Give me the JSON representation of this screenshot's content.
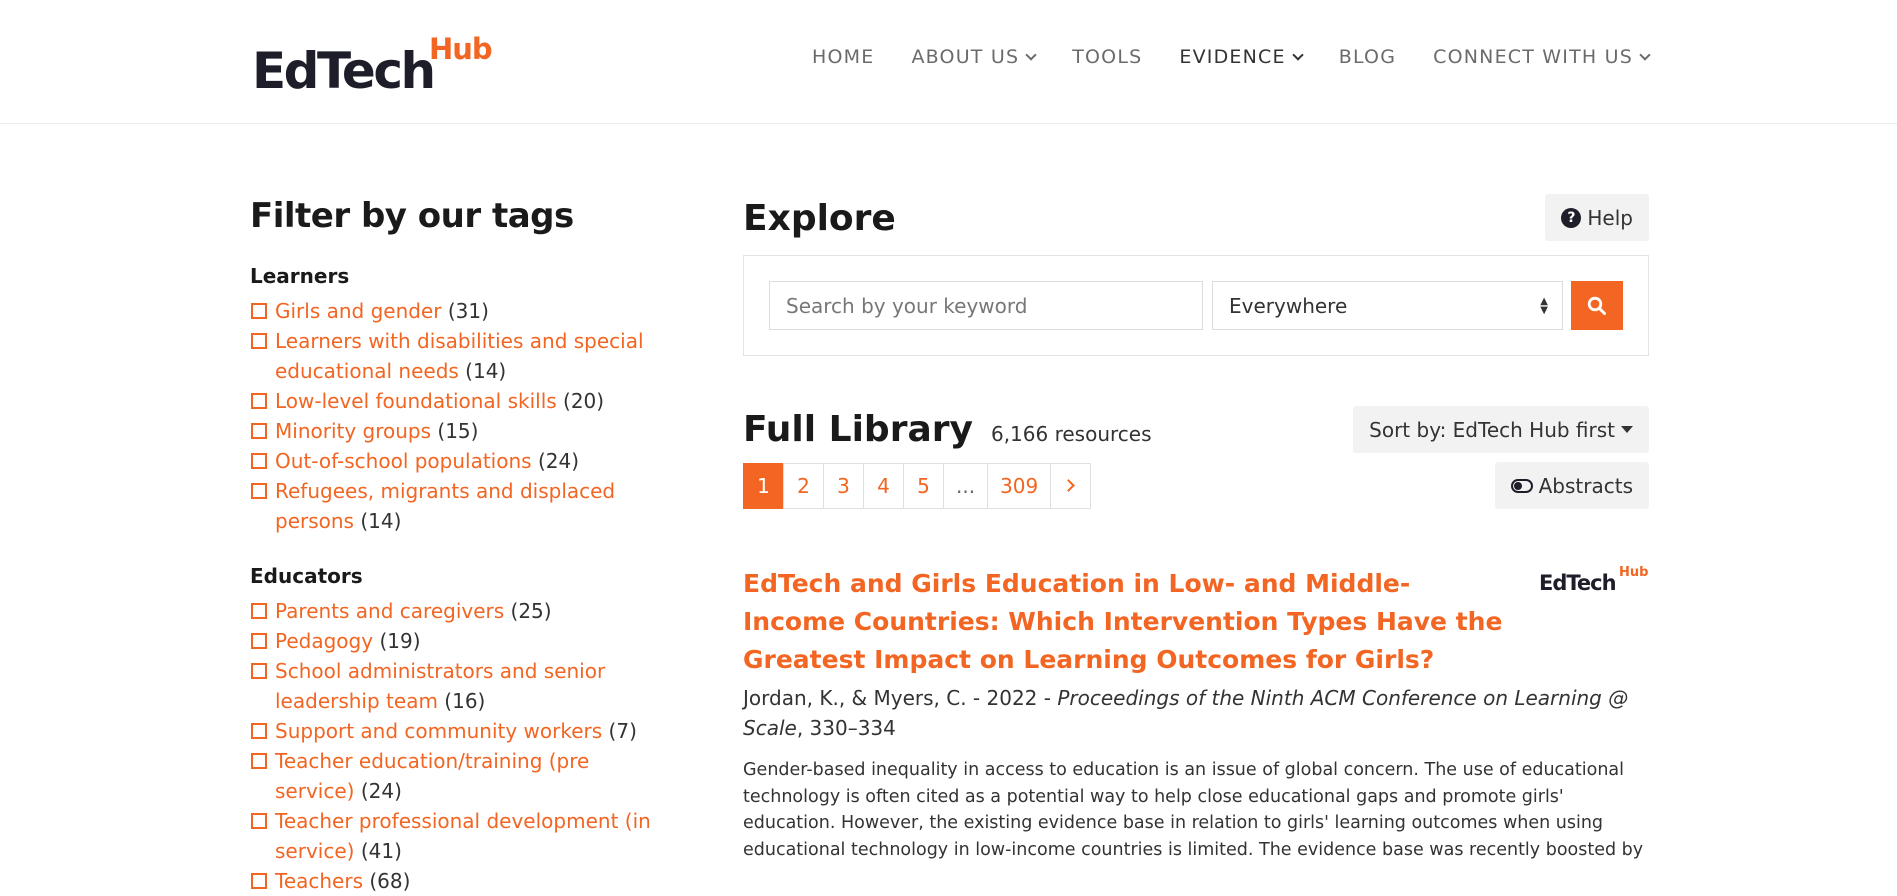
{
  "brand": {
    "main": "EdTech",
    "sup": "Hub"
  },
  "nav": [
    {
      "label": "HOME",
      "dropdown": false,
      "active": false
    },
    {
      "label": "ABOUT US",
      "dropdown": true,
      "active": false
    },
    {
      "label": "TOOLS",
      "dropdown": false,
      "active": false
    },
    {
      "label": "EVIDENCE",
      "dropdown": true,
      "active": true
    },
    {
      "label": "BLOG",
      "dropdown": false,
      "active": false
    },
    {
      "label": "CONNECT WITH US",
      "dropdown": true,
      "active": false
    }
  ],
  "sidebar": {
    "title": "Filter by our tags",
    "groups": [
      {
        "title": "Learners",
        "tags": [
          {
            "label": "Girls and gender",
            "count": "(31)"
          },
          {
            "label": "Learners with disabilities and special educational needs",
            "count": "(14)"
          },
          {
            "label": "Low-level foundational skills",
            "count": "(20)"
          },
          {
            "label": "Minority groups",
            "count": "(15)"
          },
          {
            "label": "Out-of-school populations",
            "count": "(24)"
          },
          {
            "label": "Refugees, migrants and displaced persons",
            "count": "(14)"
          }
        ]
      },
      {
        "title": "Educators",
        "tags": [
          {
            "label": "Parents and caregivers",
            "count": "(25)"
          },
          {
            "label": "Pedagogy",
            "count": "(19)"
          },
          {
            "label": "School administrators and senior leadership team",
            "count": "(16)"
          },
          {
            "label": "Support and community workers",
            "count": "(7)"
          },
          {
            "label": "Teacher education/training (pre service)",
            "count": "(24)"
          },
          {
            "label": "Teacher professional development (in service)",
            "count": "(41)"
          },
          {
            "label": "Teachers",
            "count": "(68)"
          }
        ]
      }
    ]
  },
  "explore": {
    "title": "Explore",
    "help_label": "Help",
    "search_placeholder": "Search by your keyword",
    "scope_value": "Everywhere"
  },
  "library": {
    "title": "Full Library",
    "count": "6,166 resources",
    "sort_label": "Sort by: EdTech Hub first",
    "abstracts_label": "Abstracts",
    "pages": [
      "1",
      "2",
      "3",
      "4",
      "5",
      "...",
      "309"
    ],
    "current_page": "1"
  },
  "result": {
    "title": "EdTech and Girls Education in Low- and Middle-Income Countries: Which Intervention Types Have the Greatest Impact on Learning Outcomes for Girls?",
    "authors_year": "Jordan, K., & Myers, C. - 2022 - ",
    "journal": "Proceedings of the Ninth ACM Conference on Learning @ Scale",
    "pages": ", 330–334",
    "abstract": "Gender-based inequality in access to education is an issue of global concern. The use of educational technology is often cited as a potential way to help close educational gaps and promote girls' education. However, the existing evidence base in relation to girls' learning outcomes when using educational technology in low-income countries is limited. The evidence base was recently boosted by",
    "logo_main": "EdTech",
    "logo_sup": "Hub"
  },
  "colors": {
    "accent": "#f26522",
    "dark": "#1e1e2a"
  },
  "icons": [
    "chevron-down-icon",
    "question-circle-icon",
    "search-icon",
    "select-arrows-icon",
    "caret-down-icon",
    "toggle-icon",
    "chevron-right-icon",
    "checkbox-icon"
  ]
}
